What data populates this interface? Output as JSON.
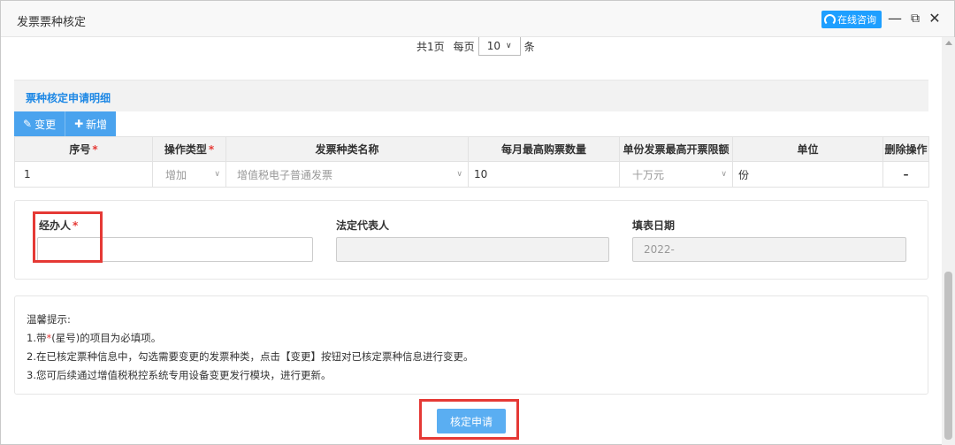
{
  "window": {
    "title": "发票票种核定",
    "online_label": "在线咨询"
  },
  "pager": {
    "total_pages": "共1页",
    "per_page_label": "每页",
    "per_page_value": "10",
    "unit": "条"
  },
  "section": {
    "title": "票种核定申请明细"
  },
  "toolbar": {
    "change_label": "变更",
    "add_label": "新增"
  },
  "table": {
    "headers": [
      "序号",
      "操作类型",
      "发票种类名称",
      "每月最高购票数量",
      "单份发票最高开票限额",
      "单位",
      "删除操作"
    ],
    "row": {
      "index": "1",
      "op_type": "增加",
      "invoice_type": "增值税电子普通发票",
      "monthly_max": "10",
      "limit": "十万元",
      "unit": "份",
      "delete": "–"
    }
  },
  "form": {
    "handler_label": "经办人",
    "handler_value": "",
    "legal_rep_label": "法定代表人",
    "legal_rep_value": "",
    "date_label": "填表日期",
    "date_value": "2022-"
  },
  "tips": {
    "title": "温馨提示:",
    "line1_pre": "1.带",
    "line1_star": "*",
    "line1_post": "(星号)的项目为必填项。",
    "line2": "2.在已核定票种信息中，勾选需要变更的发票种类，点击【变更】按钮对已核定票种信息进行变更。",
    "line3": "3.您可后续通过增值税税控系统专用设备变更发行模块，进行更新。"
  },
  "submit_label": "核定申请",
  "colors": {
    "accent": "#1e9fff",
    "required": "#e53935",
    "highlight_box": "#e53935"
  }
}
